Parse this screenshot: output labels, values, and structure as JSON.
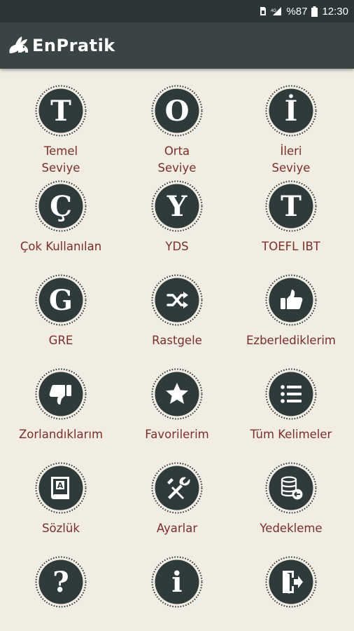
{
  "status_bar": {
    "battery_percent": "%87",
    "time": "12:30",
    "icons": [
      "sim-icon",
      "signal-icon",
      "battery-icon"
    ]
  },
  "app_bar": {
    "title": "EnPratik",
    "logo": "rabbit-logo-icon"
  },
  "colors": {
    "status_bar": "#2d3636",
    "app_bar": "#3b4444",
    "background": "#f1ede3",
    "badge": "#2f3a3b",
    "label": "#7a2f2a"
  },
  "menu": [
    {
      "line1": "Temel",
      "line2": "Seviye",
      "icon": "letter-t-icon",
      "glyph": "T"
    },
    {
      "line1": "Orta",
      "line2": "Seviye",
      "icon": "letter-o-icon",
      "glyph": "O"
    },
    {
      "line1": "İleri",
      "line2": "Seviye",
      "icon": "letter-i-icon",
      "glyph": "İ"
    },
    {
      "line1": "Çok Kullanılan",
      "icon": "letter-c-cedilla-icon",
      "glyph": "Ç"
    },
    {
      "line1": "YDS",
      "icon": "letter-y-icon",
      "glyph": "Y"
    },
    {
      "line1": "TOEFL IBT",
      "icon": "letter-t-icon",
      "glyph": "T"
    },
    {
      "line1": "GRE",
      "icon": "letter-g-icon",
      "glyph": "G"
    },
    {
      "line1": "Rastgele",
      "icon": "shuffle-icon"
    },
    {
      "line1": "Ezberlediklerim",
      "icon": "thumbs-up-icon"
    },
    {
      "line1": "Zorlandıklarım",
      "icon": "thumbs-down-icon"
    },
    {
      "line1": "Favorilerim",
      "icon": "star-icon"
    },
    {
      "line1": "Tüm Kelimeler",
      "icon": "list-icon"
    },
    {
      "line1": "Sözlük",
      "icon": "dictionary-book-icon",
      "glyph": "A"
    },
    {
      "line1": "Ayarlar",
      "icon": "tools-icon"
    },
    {
      "line1": "Yedekleme",
      "icon": "database-backup-icon"
    },
    {
      "line1": "",
      "icon": "question-mark-icon",
      "glyph": "?"
    },
    {
      "line1": "",
      "icon": "info-icon",
      "glyph": "i"
    },
    {
      "line1": "",
      "icon": "exit-door-icon"
    }
  ]
}
